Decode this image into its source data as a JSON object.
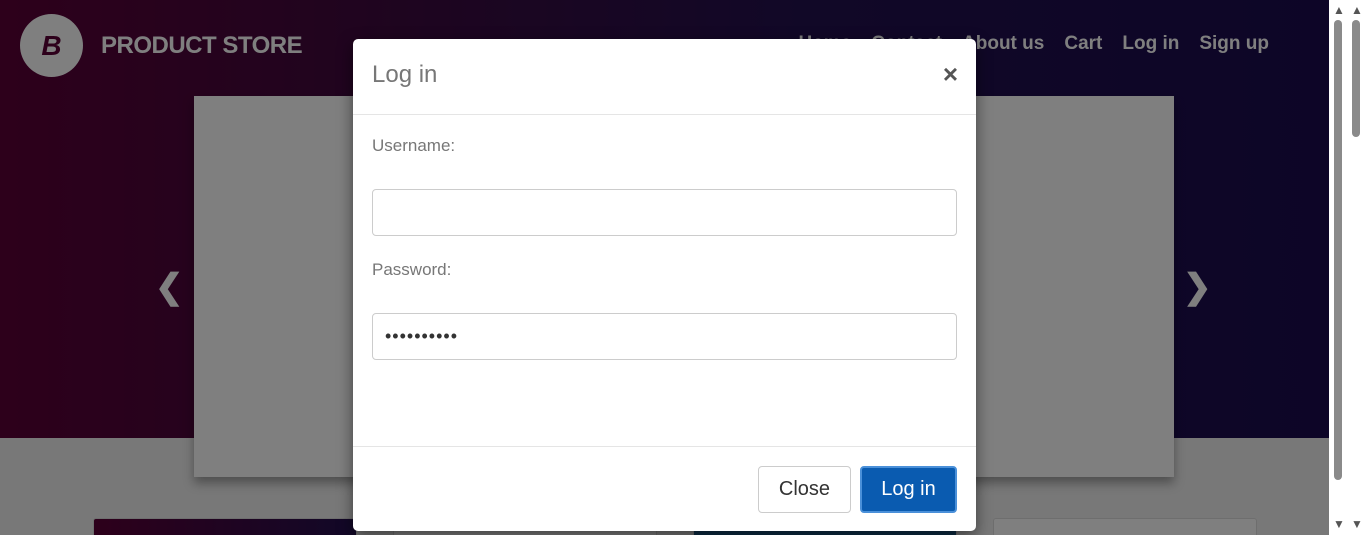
{
  "navbar": {
    "brand_logo_letter": "B",
    "brand_name": "PRODUCT STORE",
    "links": [
      "Home",
      "Contact",
      "About us",
      "Cart",
      "Log in",
      "Sign up"
    ]
  },
  "carousel": {
    "prev_icon": "chevron-left-icon",
    "next_icon": "chevron-right-icon"
  },
  "modal": {
    "title": "Log in",
    "close_symbol": "×",
    "username_label": "Username:",
    "username_value": "",
    "password_label": "Password:",
    "password_value": "••••••••••",
    "close_button": "Close",
    "login_button": "Log in"
  },
  "colors": {
    "primary_button": "#0a5bb0",
    "hero_start": "#5b0036",
    "hero_end": "#1a0b4f"
  }
}
